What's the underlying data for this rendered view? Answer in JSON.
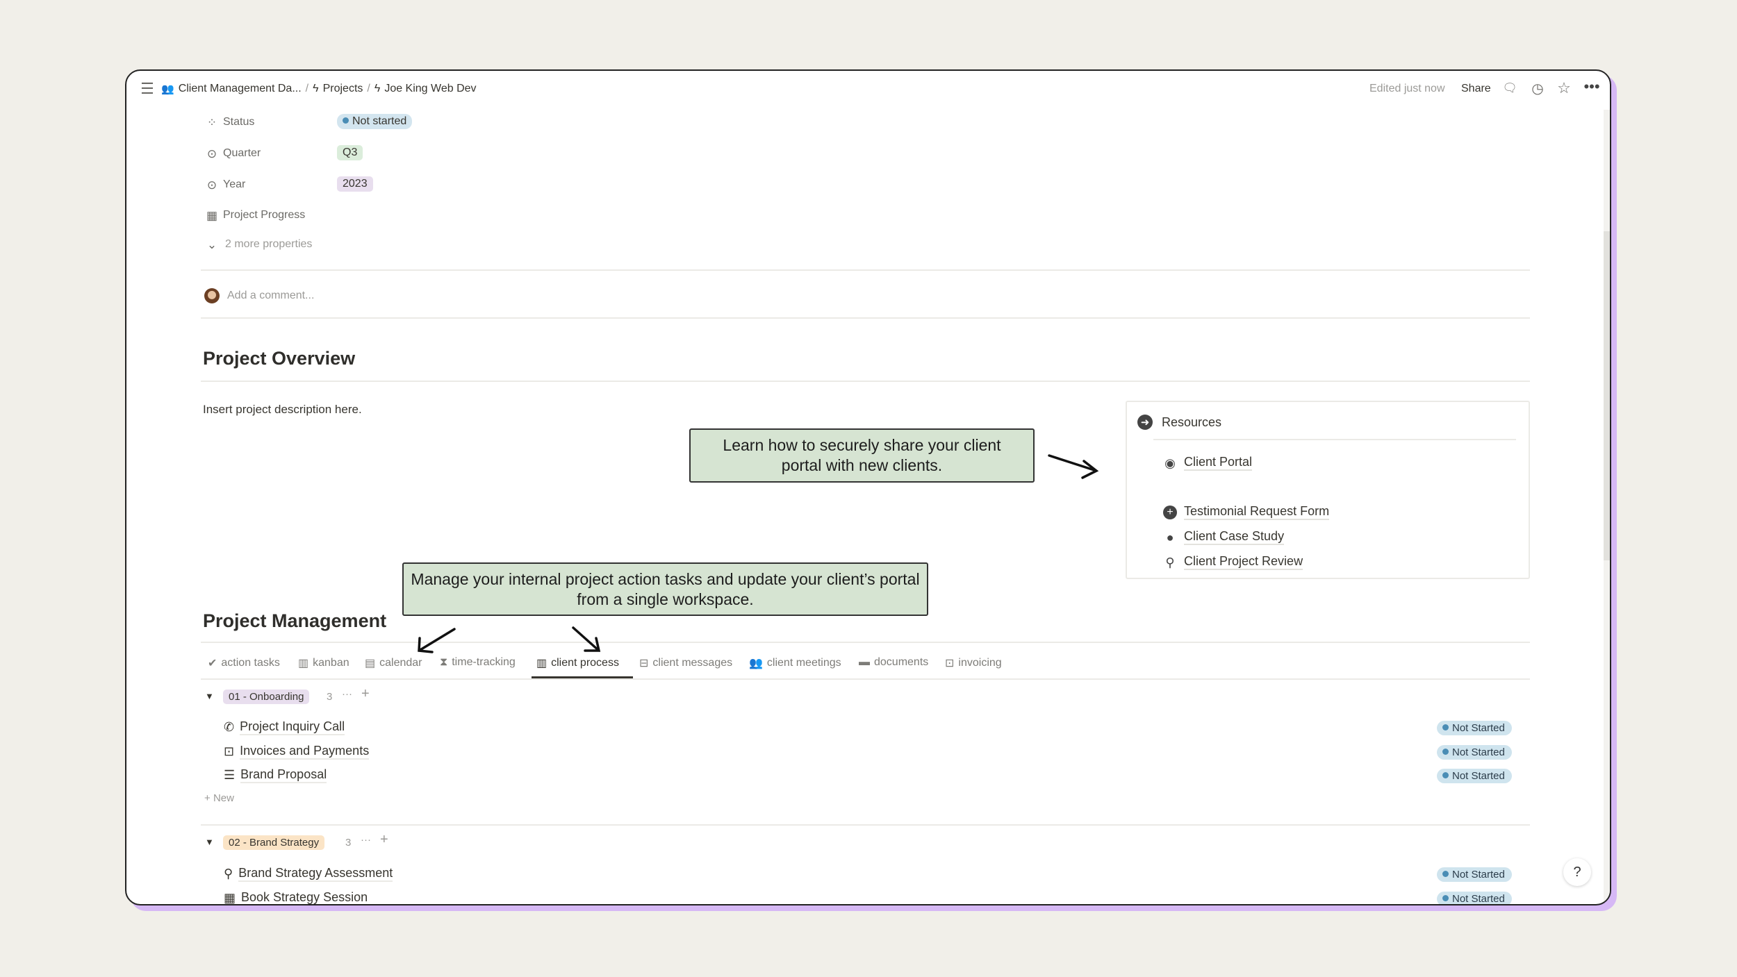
{
  "topbar": {
    "breadcrumbs": [
      "Client Management Da...",
      "Projects",
      "Joe King Web Dev"
    ],
    "separator": "/",
    "edited": "Edited just now",
    "share": "Share"
  },
  "properties": [
    {
      "label": "Status",
      "value": "Not started",
      "icon": "status-icon",
      "color": "#d3e5ef"
    },
    {
      "label": "Quarter",
      "value": "Q3",
      "icon": "select-icon",
      "color": "#dbeddb"
    },
    {
      "label": "Year",
      "value": "2023",
      "icon": "select-icon",
      "color": "#e8deee"
    },
    {
      "label": "Project Progress",
      "value": "",
      "icon": "chart-icon"
    }
  ],
  "more_properties": "2 more properties",
  "comment_placeholder": "Add a comment...",
  "overview": {
    "title": "Project Overview",
    "description": "Insert project description here."
  },
  "callouts": [
    "Learn how to securely share your client portal with new clients.",
    "Manage your internal project action tasks and update your client’s portal from a single workspace."
  ],
  "resources": {
    "title": "Resources",
    "items": [
      {
        "label": "Client Portal",
        "icon": "user-circle-icon"
      },
      {
        "label": "Testimonial Request Form",
        "icon": "chat-plus-icon"
      },
      {
        "label": "Client Case Study",
        "icon": "user-filled-icon"
      },
      {
        "label": "Client Project Review",
        "icon": "search-icon"
      }
    ]
  },
  "management": {
    "title": "Project Management",
    "tabs": [
      "action tasks",
      "kanban",
      "calendar",
      "time-tracking",
      "client process",
      "client messages",
      "client meetings",
      "documents",
      "invoicing"
    ],
    "active_tab": "client process",
    "groups": [
      {
        "name": "01 - Onboarding",
        "count": "3",
        "color": "#e8deee",
        "items": [
          {
            "label": "Project Inquiry Call",
            "status": "Not Started",
            "icon": "phone-icon"
          },
          {
            "label": "Invoices and Payments",
            "status": "Not Started",
            "icon": "money-icon"
          },
          {
            "label": "Brand Proposal",
            "status": "Not Started",
            "icon": "edit-list-icon"
          }
        ],
        "new_label": "New"
      },
      {
        "name": "02 - Brand Strategy",
        "count": "3",
        "color": "#fbe4c6",
        "items": [
          {
            "label": "Brand Strategy Assessment",
            "status": "Not Started",
            "icon": "search-icon"
          },
          {
            "label": "Book Strategy Session",
            "status": "Not Started",
            "icon": "calendar-icon"
          }
        ]
      }
    ]
  },
  "help": "?"
}
